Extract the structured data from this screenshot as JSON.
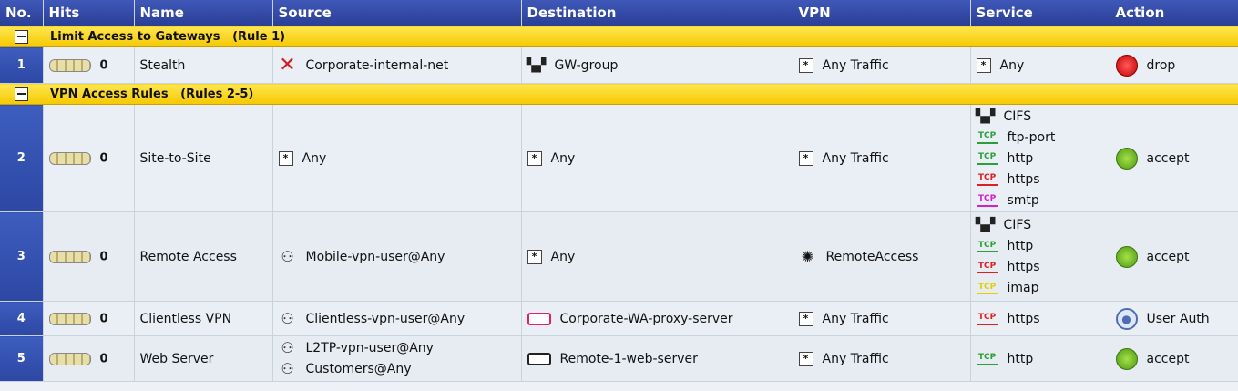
{
  "columns": [
    "No.",
    "Hits",
    "Name",
    "Source",
    "Destination",
    "VPN",
    "Service",
    "Action"
  ],
  "sections": [
    {
      "title": "Limit Access to Gateways",
      "range": "(Rule 1)",
      "rules": [
        {
          "no": "1",
          "hits": "0",
          "name": "Stealth",
          "source": [
            {
              "icon": "x-icon",
              "text": "Corporate-internal-net"
            }
          ],
          "destination": [
            {
              "icon": "network-group-icon",
              "text": "GW-group"
            }
          ],
          "vpn": {
            "icon": "any-icon",
            "text": "Any Traffic"
          },
          "service": [
            {
              "icon": "any-icon",
              "text": "Any"
            }
          ],
          "action": {
            "icon": "drop-icon",
            "text": "drop"
          }
        }
      ]
    },
    {
      "title": "VPN Access Rules",
      "range": "(Rules 2-5)",
      "rules": [
        {
          "no": "2",
          "hits": "0",
          "name": "Site-to-Site",
          "source": [
            {
              "icon": "any-icon",
              "text": "Any"
            }
          ],
          "destination": [
            {
              "icon": "any-icon",
              "text": "Any"
            }
          ],
          "vpn": {
            "icon": "any-icon",
            "text": "Any Traffic"
          },
          "service": [
            {
              "icon": "service-group-icon",
              "text": "CIFS"
            },
            {
              "icon": "tcp-green-icon",
              "text": "ftp-port"
            },
            {
              "icon": "tcp-green-icon",
              "text": "http"
            },
            {
              "icon": "tcp-red-icon",
              "text": "https"
            },
            {
              "icon": "tcp-pink-icon",
              "text": "smtp"
            }
          ],
          "action": {
            "icon": "accept-icon",
            "text": "accept"
          }
        },
        {
          "no": "3",
          "hits": "0",
          "name": "Remote Access",
          "source": [
            {
              "icon": "user-group-icon",
              "text": "Mobile-vpn-user@Any"
            }
          ],
          "destination": [
            {
              "icon": "any-icon",
              "text": "Any"
            }
          ],
          "vpn": {
            "icon": "community-icon",
            "text": "RemoteAccess"
          },
          "service": [
            {
              "icon": "service-group-icon",
              "text": "CIFS"
            },
            {
              "icon": "tcp-green-icon",
              "text": "http"
            },
            {
              "icon": "tcp-red-icon",
              "text": "https"
            },
            {
              "icon": "tcp-yellow-icon",
              "text": "imap"
            }
          ],
          "action": {
            "icon": "accept-icon",
            "text": "accept"
          }
        },
        {
          "no": "4",
          "hits": "0",
          "name": "Clientless VPN",
          "source": [
            {
              "icon": "user-group-icon",
              "text": "Clientless-vpn-user@Any"
            }
          ],
          "destination": [
            {
              "icon": "server-pink-icon",
              "text": "Corporate-WA-proxy-server"
            }
          ],
          "vpn": {
            "icon": "any-icon",
            "text": "Any Traffic"
          },
          "service": [
            {
              "icon": "tcp-red-icon",
              "text": "https"
            }
          ],
          "action": {
            "icon": "user-auth-icon",
            "text": "User Auth"
          }
        },
        {
          "no": "5",
          "hits": "0",
          "name": "Web Server",
          "source": [
            {
              "icon": "user-group-icon",
              "text": "L2TP-vpn-user@Any"
            },
            {
              "icon": "user-group-icon",
              "text": "Customers@Any"
            }
          ],
          "destination": [
            {
              "icon": "server-icon",
              "text": "Remote-1-web-server"
            }
          ],
          "vpn": {
            "icon": "any-icon",
            "text": "Any Traffic"
          },
          "service": [
            {
              "icon": "tcp-green-icon",
              "text": "http"
            }
          ],
          "action": {
            "icon": "accept-icon",
            "text": "accept"
          }
        }
      ]
    }
  ],
  "colors": {
    "header_bg": "#2f48a5",
    "section_bg": "#f7cf00",
    "row_bg": "#eaeff5",
    "accept": "#5aa81a",
    "drop": "#d40000"
  }
}
